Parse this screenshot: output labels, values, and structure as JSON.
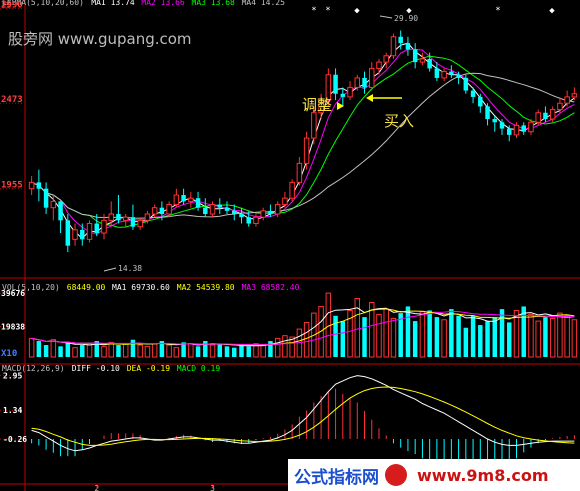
{
  "corner_label": "线",
  "watermarks": {
    "top": "股旁网 www.gupang.com",
    "bottom_cn": "公式指标网",
    "bottom_url": "www.9m8.com"
  },
  "annotations": {
    "adjust": "调整",
    "buy": "买入"
  },
  "colors": {
    "up": "#ff3232",
    "down": "#00ffff",
    "ma1": "#ffffff",
    "ma2": "#ff00ff",
    "ma3": "#00ff00",
    "ma4": "#c0c0c0",
    "yellow": "#ffff00",
    "axis": "#c00000"
  },
  "chart_data": [
    {
      "type": "candlestick",
      "legend": [
        {
          "text": "EXPMA(5,10,20,60)",
          "color": "#c0c0c0"
        },
        {
          "text": "MA1 13.74",
          "color": "#ffffff"
        },
        {
          "text": "MA2 13.66",
          "color": "#ff00ff"
        },
        {
          "text": "MA3 13.68",
          "color": "#00ff00"
        },
        {
          "text": "MA4 14.25",
          "color": "#c0c0c0"
        }
      ],
      "y_ticks": [
        "2990",
        "2473",
        "1955"
      ],
      "labels": {
        "high": "29.90",
        "low": "14.38"
      },
      "markers": [
        "*",
        "*",
        "◆",
        "◆",
        "*",
        "◆"
      ],
      "candles": [
        [
          1.0,
          1.1,
          1.2,
          0.9
        ],
        [
          1.1,
          1.0,
          1.3,
          0.8
        ],
        [
          1.0,
          0.7,
          1.1,
          0.6
        ],
        [
          0.7,
          0.8,
          0.9,
          0.5
        ],
        [
          0.8,
          0.5,
          0.8,
          0.3
        ],
        [
          0.5,
          0.1,
          0.6,
          0.0
        ],
        [
          0.2,
          0.35,
          0.45,
          0.1
        ],
        [
          0.35,
          0.2,
          0.45,
          0.1
        ],
        [
          0.2,
          0.45,
          0.5,
          0.15
        ],
        [
          0.45,
          0.3,
          0.6,
          0.25
        ],
        [
          0.3,
          0.5,
          0.6,
          0.2
        ],
        [
          0.5,
          0.6,
          0.8,
          0.4
        ],
        [
          0.6,
          0.5,
          0.9,
          0.45
        ],
        [
          0.5,
          0.55,
          0.6,
          0.4
        ],
        [
          0.55,
          0.4,
          0.75,
          0.35
        ],
        [
          0.4,
          0.5,
          0.55,
          0.35
        ],
        [
          0.5,
          0.6,
          0.65,
          0.45
        ],
        [
          0.6,
          0.7,
          0.75,
          0.55
        ],
        [
          0.7,
          0.6,
          0.8,
          0.5
        ],
        [
          0.6,
          0.75,
          0.8,
          0.55
        ],
        [
          0.75,
          0.9,
          1.0,
          0.7
        ],
        [
          0.9,
          0.8,
          1.0,
          0.75
        ],
        [
          0.8,
          0.85,
          0.95,
          0.7
        ],
        [
          0.85,
          0.7,
          0.95,
          0.65
        ],
        [
          0.7,
          0.6,
          0.85,
          0.55
        ],
        [
          0.6,
          0.75,
          0.8,
          0.55
        ],
        [
          0.75,
          0.7,
          0.85,
          0.6
        ],
        [
          0.7,
          0.65,
          0.8,
          0.6
        ],
        [
          0.65,
          0.6,
          0.75,
          0.5
        ],
        [
          0.6,
          0.55,
          0.7,
          0.45
        ],
        [
          0.55,
          0.45,
          0.65,
          0.4
        ],
        [
          0.45,
          0.55,
          0.6,
          0.4
        ],
        [
          0.55,
          0.65,
          0.7,
          0.5
        ],
        [
          0.65,
          0.6,
          0.75,
          0.55
        ],
        [
          0.6,
          0.75,
          0.8,
          0.55
        ],
        [
          0.75,
          0.85,
          0.95,
          0.7
        ],
        [
          0.85,
          1.1,
          1.15,
          0.8
        ],
        [
          1.1,
          1.4,
          1.5,
          1.05
        ],
        [
          1.4,
          1.8,
          1.9,
          1.3
        ],
        [
          1.8,
          2.2,
          2.3,
          1.7
        ],
        [
          2.2,
          2.4,
          2.5,
          2.1
        ],
        [
          2.4,
          2.8,
          2.9,
          2.3
        ],
        [
          2.8,
          2.5,
          2.9,
          2.4
        ],
        [
          2.5,
          2.45,
          2.6,
          2.3
        ],
        [
          2.45,
          2.6,
          2.7,
          2.4
        ],
        [
          2.6,
          2.75,
          2.8,
          2.55
        ],
        [
          2.75,
          2.6,
          2.85,
          2.5
        ],
        [
          2.6,
          2.9,
          3.0,
          2.55
        ],
        [
          2.9,
          3.0,
          3.05,
          2.8
        ],
        [
          3.0,
          3.1,
          3.15,
          2.9
        ],
        [
          3.1,
          3.4,
          3.45,
          3.05
        ],
        [
          3.4,
          3.3,
          3.5,
          3.2
        ],
        [
          3.3,
          3.2,
          3.4,
          3.1
        ],
        [
          3.2,
          3.0,
          3.3,
          2.9
        ],
        [
          3.0,
          3.05,
          3.15,
          2.95
        ],
        [
          3.05,
          2.9,
          3.15,
          2.85
        ],
        [
          2.9,
          2.75,
          3.0,
          2.7
        ],
        [
          2.75,
          2.85,
          2.9,
          2.7
        ],
        [
          2.85,
          2.8,
          2.95,
          2.75
        ],
        [
          2.8,
          2.75,
          2.85,
          2.65
        ],
        [
          2.75,
          2.55,
          2.8,
          2.5
        ],
        [
          2.55,
          2.45,
          2.6,
          2.35
        ],
        [
          2.45,
          2.3,
          2.5,
          2.2
        ],
        [
          2.3,
          2.1,
          2.35,
          2.0
        ],
        [
          2.1,
          2.05,
          2.15,
          1.9
        ],
        [
          2.05,
          1.95,
          2.1,
          1.85
        ],
        [
          1.95,
          1.85,
          2.0,
          1.75
        ],
        [
          1.85,
          2.0,
          2.05,
          1.8
        ],
        [
          2.0,
          1.9,
          2.05,
          1.85
        ],
        [
          1.9,
          2.05,
          2.1,
          1.85
        ],
        [
          2.05,
          2.2,
          2.25,
          2.0
        ],
        [
          2.2,
          2.1,
          2.3,
          2.05
        ],
        [
          2.1,
          2.25,
          2.3,
          2.05
        ],
        [
          2.25,
          2.35,
          2.45,
          2.2
        ],
        [
          2.35,
          2.45,
          2.55,
          2.3
        ],
        [
          2.45,
          2.5,
          2.6,
          2.4
        ]
      ]
    },
    {
      "type": "bar",
      "legend": [
        {
          "text": "VOL(5,10,20)",
          "color": "#c0c0c0"
        },
        {
          "text": "68449.00",
          "color": "#ffff00"
        },
        {
          "text": "MA1 69730.60",
          "color": "#ffffff"
        },
        {
          "text": "MA2 54539.80",
          "color": "#ffff00"
        },
        {
          "text": "MA3 68582.40",
          "color": "#ff00ff"
        }
      ],
      "y_ticks": [
        "39676",
        "19838",
        "X10"
      ],
      "values": [
        14,
        12,
        9,
        13,
        8,
        11,
        7,
        9,
        10,
        12,
        8,
        11,
        9,
        10,
        13,
        9,
        8,
        10,
        12,
        9,
        7,
        11,
        10,
        8,
        12,
        9,
        10,
        8,
        7,
        9,
        8,
        10,
        9,
        12,
        14,
        16,
        15,
        21,
        26,
        33,
        38,
        48,
        31,
        27,
        35,
        44,
        30,
        41,
        32,
        36,
        29,
        33,
        38,
        27,
        34,
        35,
        30,
        28,
        36,
        31,
        22,
        31,
        24,
        27,
        30,
        36,
        26,
        35,
        38,
        32,
        27,
        30,
        29,
        33,
        31,
        28
      ]
    },
    {
      "type": "macd",
      "legend": [
        {
          "text": "MACD(12,26,9)",
          "color": "#c0c0c0"
        },
        {
          "text": "DIFF -0.10",
          "color": "#ffffff"
        },
        {
          "text": "DEA -0.19",
          "color": "#ffff00"
        },
        {
          "text": "MACD 0.19",
          "color": "#00ff00"
        }
      ],
      "y_ticks": [
        "2.95",
        "1.34",
        "-0.26"
      ],
      "x_ticks": [
        "2",
        "3"
      ],
      "diff": [
        0.4,
        0.3,
        0.1,
        -0.1,
        -0.3,
        -0.45,
        -0.55,
        -0.5,
        -0.42,
        -0.3,
        -0.2,
        -0.1,
        -0.05,
        0.0,
        0.05,
        0.05,
        0.0,
        -0.05,
        -0.05,
        0.0,
        0.05,
        0.1,
        0.1,
        0.05,
        0.0,
        -0.05,
        -0.05,
        -0.1,
        -0.15,
        -0.2,
        -0.2,
        -0.15,
        -0.1,
        -0.05,
        0.05,
        0.2,
        0.4,
        0.7,
        1.0,
        1.4,
        1.8,
        2.2,
        2.55,
        2.7,
        2.85,
        2.95,
        2.9,
        2.8,
        2.65,
        2.5,
        2.3,
        2.15,
        2.0,
        1.85,
        1.65,
        1.5,
        1.35,
        1.2,
        1.0,
        0.8,
        0.6,
        0.4,
        0.2,
        0.0,
        -0.15,
        -0.25,
        -0.3,
        -0.3,
        -0.25,
        -0.2,
        -0.15,
        -0.12,
        -0.1,
        -0.1,
        -0.1,
        -0.1
      ],
      "dea": [
        0.5,
        0.45,
        0.35,
        0.22,
        0.1,
        -0.05,
        -0.15,
        -0.25,
        -0.3,
        -0.3,
        -0.28,
        -0.24,
        -0.18,
        -0.13,
        -0.08,
        -0.04,
        -0.02,
        -0.02,
        -0.03,
        -0.03,
        -0.02,
        0.0,
        0.02,
        0.03,
        0.03,
        0.02,
        0.0,
        -0.02,
        -0.05,
        -0.08,
        -0.1,
        -0.12,
        -0.12,
        -0.1,
        -0.07,
        -0.02,
        0.06,
        0.18,
        0.34,
        0.55,
        0.8,
        1.08,
        1.38,
        1.65,
        1.9,
        2.1,
        2.25,
        2.35,
        2.4,
        2.42,
        2.4,
        2.35,
        2.28,
        2.2,
        2.1,
        1.98,
        1.85,
        1.72,
        1.57,
        1.42,
        1.25,
        1.08,
        0.9,
        0.72,
        0.55,
        0.4,
        0.27,
        0.15,
        0.06,
        0.0,
        -0.05,
        -0.09,
        -0.12,
        -0.15,
        -0.17,
        -0.19
      ]
    }
  ]
}
